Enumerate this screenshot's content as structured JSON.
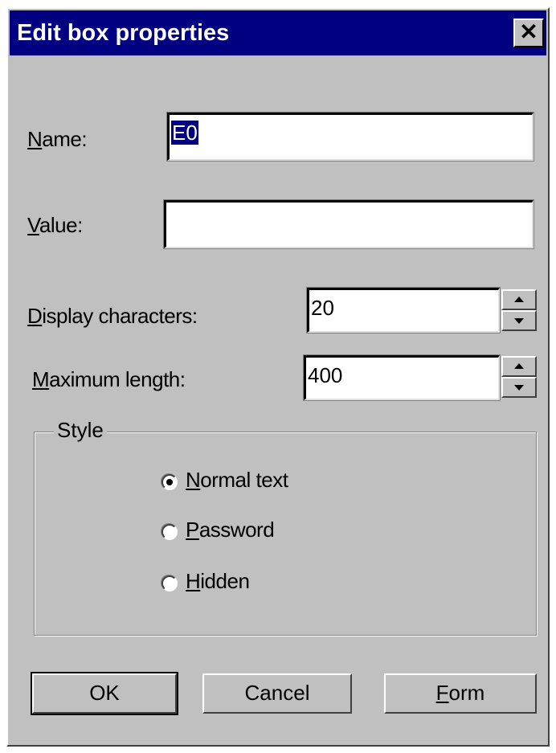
{
  "window": {
    "title": "Edit box properties",
    "close_glyph": "✕"
  },
  "fields": {
    "name_label_mnemonic": "N",
    "name_label_rest": "ame:",
    "name_value": "E0",
    "value_label_mnemonic": "V",
    "value_label_rest": "alue:",
    "value_value": "",
    "display_label_mnemonic": "D",
    "display_label_rest": "isplay characters:",
    "display_value": "20",
    "maxlen_label_mnemonic": "M",
    "maxlen_label_rest": "aximum length:",
    "maxlen_value": "400"
  },
  "style_group": {
    "legend": "Style",
    "options": [
      {
        "mnemonic": "N",
        "rest": "ormal text",
        "selected": true
      },
      {
        "mnemonic": "P",
        "rest": "assword",
        "selected": false
      },
      {
        "mnemonic": "H",
        "rest": "idden",
        "selected": false
      }
    ]
  },
  "buttons": {
    "ok": "OK",
    "cancel": "Cancel",
    "form_mnemonic": "F",
    "form_rest": "orm"
  },
  "icons": {
    "close": "close-icon",
    "spin_up": "arrow-up-icon",
    "spin_down": "arrow-down-icon",
    "radio_selected": "radio-selected-icon",
    "radio_unselected": "radio-unselected-icon"
  },
  "colors": {
    "titlebar": "#000080",
    "dialog_face": "#c0c0c0",
    "selection": "#000080"
  }
}
